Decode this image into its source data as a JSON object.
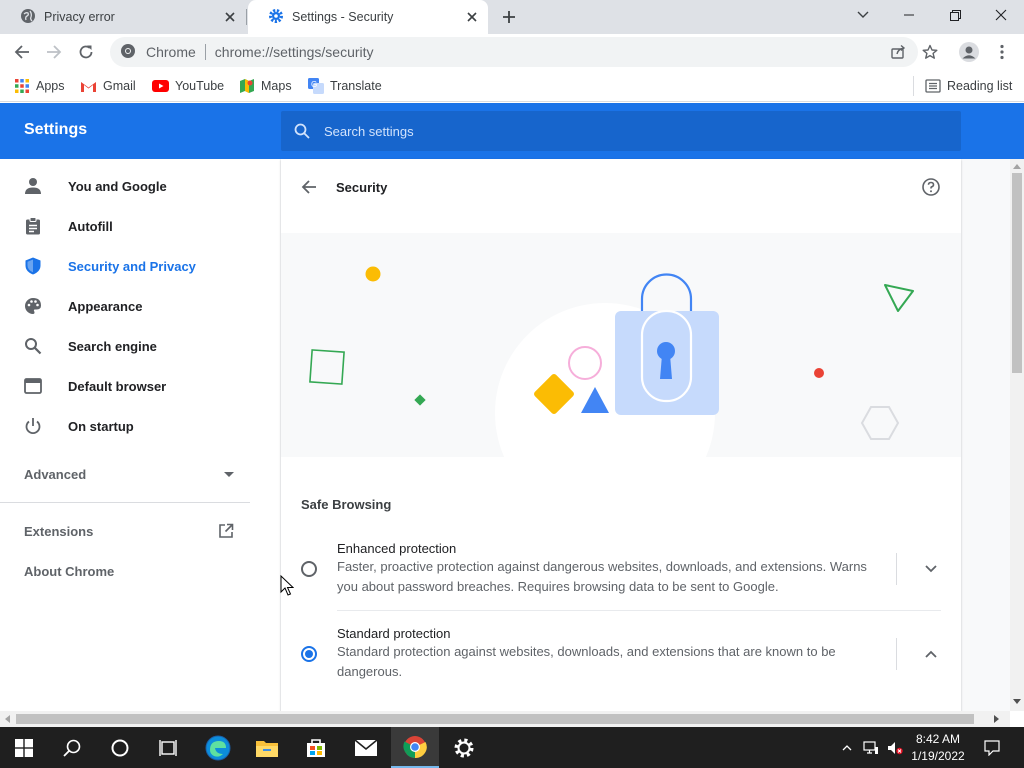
{
  "tabs": [
    {
      "title": "Privacy error",
      "icon": "globe-icon"
    },
    {
      "title": "Settings - Security",
      "icon": "gear-icon"
    }
  ],
  "toolbar": {
    "origin_label": "Chrome",
    "url": "chrome://settings/security"
  },
  "bookmarks": {
    "items": [
      {
        "label": "Apps",
        "icon": "apps-grid-icon"
      },
      {
        "label": "Gmail",
        "icon": "gmail-icon"
      },
      {
        "label": "YouTube",
        "icon": "youtube-icon"
      },
      {
        "label": "Maps",
        "icon": "maps-icon"
      },
      {
        "label": "Translate",
        "icon": "translate-icon"
      }
    ],
    "reading_list": "Reading list"
  },
  "settings": {
    "title": "Settings",
    "search_placeholder": "Search settings"
  },
  "sidebar": {
    "items": [
      {
        "label": "You and Google",
        "icon": "person-icon"
      },
      {
        "label": "Autofill",
        "icon": "clipboard-icon"
      },
      {
        "label": "Security and Privacy",
        "icon": "shield-icon"
      },
      {
        "label": "Appearance",
        "icon": "palette-icon"
      },
      {
        "label": "Search engine",
        "icon": "search-icon"
      },
      {
        "label": "Default browser",
        "icon": "browser-icon"
      },
      {
        "label": "On startup",
        "icon": "power-icon"
      }
    ],
    "advanced": "Advanced",
    "extensions": "Extensions",
    "about": "About Chrome"
  },
  "page": {
    "title": "Security",
    "section_heading": "Safe Browsing",
    "options": [
      {
        "title": "Enhanced protection",
        "desc_line1": "Faster, proactive protection against dangerous websites, downloads, and extensions. Warns",
        "desc_line2": "you about password breaches. Requires browsing data to be sent to Google.",
        "checked": false
      },
      {
        "title": "Standard protection",
        "desc_line1": "Standard protection against websites, downloads, and extensions that are known to be",
        "desc_line2": "dangerous.",
        "checked": true
      }
    ]
  },
  "taskbar": {
    "time": "8:42 AM",
    "date": "1/19/2022"
  },
  "colors": {
    "accent": "#1a73e8",
    "header": "#1a73e8",
    "search_bg": "#1765cc"
  }
}
